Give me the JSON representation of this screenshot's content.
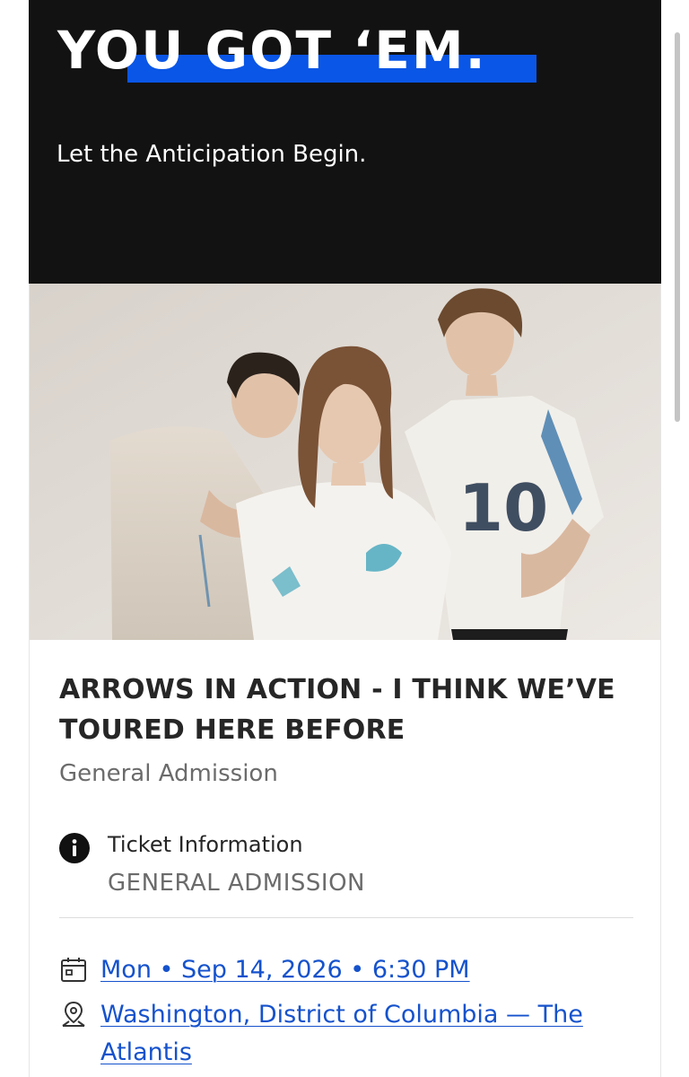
{
  "hero": {
    "title": "YOU GOT ‘EM.",
    "subtitle": "Let the Anticipation Begin.",
    "accent_color": "#0a56e6",
    "background_color": "#121212"
  },
  "event": {
    "title": "ARROWS IN ACTION - I THINK WE’VE TOURED HERE BEFORE",
    "admission_type": "General Admission",
    "ticket_info": {
      "label": "Ticket Information",
      "value": "GENERAL ADMISSION",
      "icon": "info-icon"
    },
    "date": {
      "text": "Mon • Sep 14, 2026 • 6:30 PM",
      "icon": "calendar-icon"
    },
    "venue": {
      "text": "Washington, District of Columbia — The Atlantis",
      "icon": "location-pin-icon"
    },
    "link_color": "#1552cc"
  }
}
